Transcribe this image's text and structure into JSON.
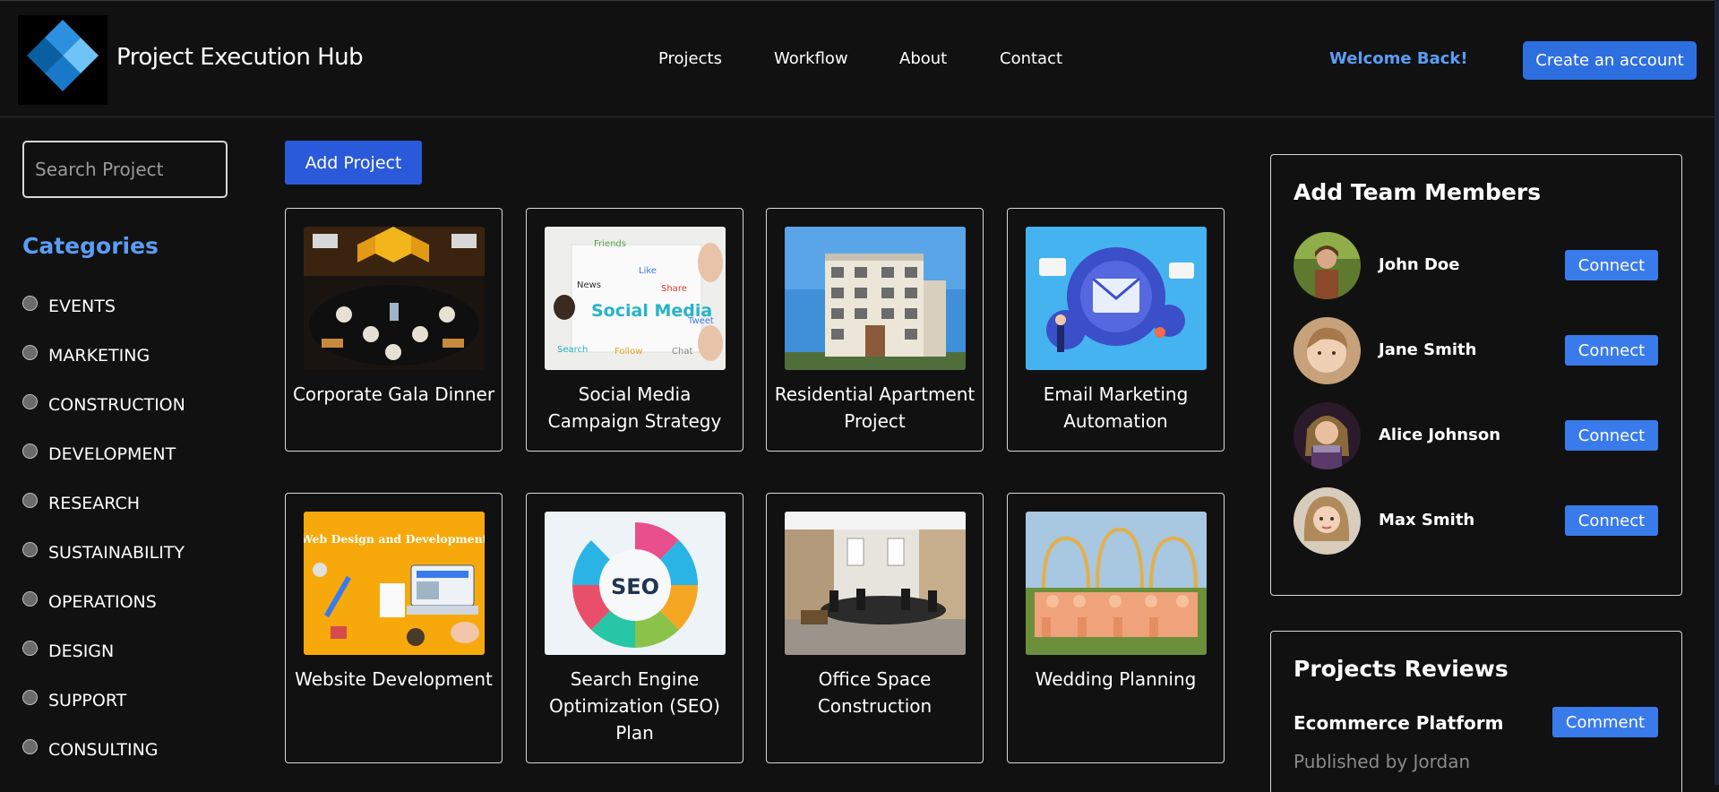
{
  "header": {
    "app_title": "Project Execution Hub",
    "nav": [
      "Projects",
      "Workflow",
      "About",
      "Contact"
    ],
    "welcome": "Welcome Back!",
    "create_account": "Create an account"
  },
  "sidebar": {
    "search_placeholder": "Search Project",
    "categories_title": "Categories",
    "categories": [
      "EVENTS",
      "MARKETING",
      "CONSTRUCTION",
      "DEVELOPMENT",
      "RESEARCH",
      "SUSTAINABILITY",
      "OPERATIONS",
      "DESIGN",
      "SUPPORT",
      "CONSULTING"
    ]
  },
  "main": {
    "add_project": "Add Project",
    "projects": [
      {
        "title": "Corporate Gala Dinner"
      },
      {
        "title": "Social Media Campaign Strategy"
      },
      {
        "title": "Residential Apartment Project"
      },
      {
        "title": "Email Marketing Automation"
      },
      {
        "title": "Website Development",
        "image_text": "Web Design and Development"
      },
      {
        "title": "Search Engine Optimization (SEO) Plan",
        "image_text": "SEO"
      },
      {
        "title": "Office Space Construction"
      },
      {
        "title": "Wedding Planning"
      }
    ]
  },
  "team_panel": {
    "title": "Add Team Members",
    "connect_label": "Connect",
    "members": [
      {
        "name": "John Doe"
      },
      {
        "name": "Jane Smith"
      },
      {
        "name": "Alice Johnson"
      },
      {
        "name": "Max Smith"
      }
    ]
  },
  "reviews_panel": {
    "title": "Projects Reviews",
    "reviews": [
      {
        "project": "Ecommerce Platform",
        "author": "Published by Jordan",
        "action": "Comment"
      }
    ]
  },
  "colors": {
    "background": "#111111",
    "accent": "#5b9df5",
    "button_primary": "#2e6fe0",
    "button_connect": "#3a7bec"
  }
}
